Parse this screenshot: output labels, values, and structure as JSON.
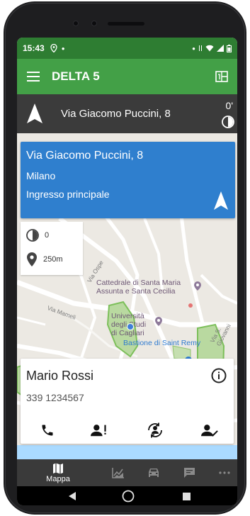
{
  "status": {
    "time": "15:43"
  },
  "appbar": {
    "title": "DELTA 5"
  },
  "navigation": {
    "street": "Via Giacomo Puccini, 8",
    "eta": "0'"
  },
  "destination": {
    "street": "Via Giacomo Puccini, 8",
    "city": "Milano",
    "entrance": "Ingresso principale"
  },
  "stats": {
    "time_value": "0",
    "distance_value": "250m"
  },
  "map": {
    "poi_cathedral": "Cattedrale di Santa Maria Assunta e Santa Cecilia",
    "poi_cathedral_line1": "Cattedrale di Santa Maria",
    "poi_cathedral_line2": "Assunta e Santa Cecilia",
    "poi_university_line1": "Università",
    "poi_university_line2": "degli Studi",
    "poi_university_line3": "di Cagliari",
    "poi_bastione": "Bastione di Saint Remy",
    "street_ospedale": "Via Ospe",
    "street_mameli": "Via Mameli",
    "street_giovanni": "Via S. Giovanni"
  },
  "contact": {
    "name": "Mario Rossi",
    "phone": "339 1234567"
  },
  "bottom_nav": {
    "map_label": "Mappa"
  },
  "colors": {
    "status_bar": "#2e7d32",
    "app_bar": "#43a047",
    "nav_bar": "#3b3b3b",
    "destination_card": "#2f7fce",
    "map_background": "#ece9e3",
    "map_green_area": "#9ccc65"
  },
  "icons": {
    "menu": "hamburger-icon",
    "grid": "grid-icon",
    "direction": "navigation-arrow-icon",
    "clock": "clock-icon",
    "pin": "location-pin-icon",
    "info": "info-icon",
    "phone": "phone-icon",
    "contact_alert": "contact-alert-icon",
    "reassign": "reassign-icon",
    "contact_check": "contact-check-icon",
    "map": "map-icon",
    "stats": "chart-icon",
    "car": "car-icon",
    "message": "message-icon",
    "more": "more-icon"
  }
}
